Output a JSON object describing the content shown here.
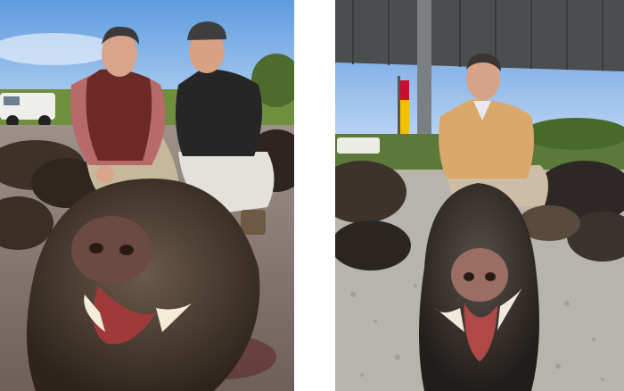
{
  "layout": "two-photo-collage",
  "photos": [
    {
      "id": "left",
      "subjects": [
        "two-hunters-crouching",
        "wild-boar-head-foreground",
        "pile-of-boars-background"
      ],
      "colors": {
        "sky": "#7fb0e6",
        "boar": "#4a3b2e",
        "vest": "#6b2a25",
        "ground": "#8b7d76"
      }
    },
    {
      "id": "right",
      "subjects": [
        "hunter-in-tan-sweater",
        "wild-boar-head-foreground",
        "canopy-roof",
        "spanish-flag",
        "gravel-ground"
      ],
      "colors": {
        "sky": "#8ab8e8",
        "boar": "#3b3530",
        "sweater": "#d9a86a",
        "gravel": "#b7b3ad",
        "roof": "#4b4d4f"
      }
    }
  ]
}
